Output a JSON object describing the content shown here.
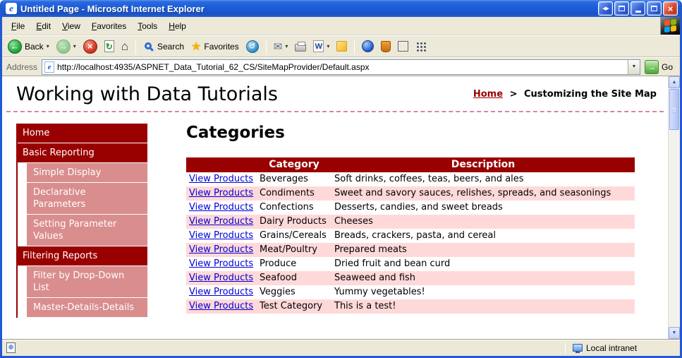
{
  "window": {
    "title": "Untitled Page - Microsoft Internet Explorer",
    "status_right_label": "Local intranet"
  },
  "menubar": {
    "items": [
      "File",
      "Edit",
      "View",
      "Favorites",
      "Tools",
      "Help"
    ]
  },
  "toolbar": {
    "back_label": "Back",
    "search_label": "Search",
    "favorites_label": "Favorites"
  },
  "addressbar": {
    "label": "Address",
    "url": "http://localhost:4935/ASPNET_Data_Tutorial_62_CS/SiteMapProvider/Default.aspx",
    "go_label": "Go"
  },
  "icons": {
    "back_arrow": "←",
    "forward_arrow": "→",
    "stop_glyph": "×",
    "refresh": "↻",
    "home": "⌂",
    "star": "★",
    "history": "↺",
    "mail": "✉",
    "caret": "▾",
    "word_w": "W",
    "go_arrow": "→",
    "up_arrow": "▲",
    "down_arrow": "▼",
    "drop_arrow": "▼",
    "close": "×",
    "arrows_pair": "◀▶",
    "ie_e": "e"
  },
  "page": {
    "title": "Working with Data Tutorials",
    "breadcrumb": {
      "home_label": "Home",
      "separator": ">",
      "current": "Customizing the Site Map"
    },
    "sidebar": [
      {
        "label": "Home",
        "level": 1
      },
      {
        "label": "Basic Reporting",
        "level": 1
      },
      {
        "label": "Simple Display",
        "level": 2
      },
      {
        "label": "Declarative Parameters",
        "level": 2
      },
      {
        "label": "Setting Parameter Values",
        "level": 2
      },
      {
        "label": "Filtering Reports",
        "level": 1
      },
      {
        "label": "Filter by Drop-Down List",
        "level": 2
      },
      {
        "label": "Master-Details-Details",
        "level": 2
      }
    ],
    "main": {
      "heading": "Categories",
      "table": {
        "headers": {
          "category": "Category",
          "description": "Description"
        },
        "link_label": "View Products",
        "rows": [
          {
            "category": "Beverages",
            "description": "Soft drinks, coffees, teas, beers, and ales"
          },
          {
            "category": "Condiments",
            "description": "Sweet and savory sauces, relishes, spreads, and seasonings"
          },
          {
            "category": "Confections",
            "description": "Desserts, candies, and sweet breads"
          },
          {
            "category": "Dairy Products",
            "description": "Cheeses"
          },
          {
            "category": "Grains/Cereals",
            "description": "Breads, crackers, pasta, and cereal"
          },
          {
            "category": "Meat/Poultry",
            "description": "Prepared meats"
          },
          {
            "category": "Produce",
            "description": "Dried fruit and bean curd"
          },
          {
            "category": "Seafood",
            "description": "Seaweed and fish"
          },
          {
            "category": "Veggies",
            "description": "Yummy vegetables!"
          },
          {
            "category": "Test Category",
            "description": "This is a test!"
          }
        ]
      }
    }
  },
  "colors": {
    "maroon": "#990000",
    "submenu_salmon": "#d98d8d",
    "row_alt_pink": "#ffd9d9",
    "link_blue": "#0000d8",
    "titlebar_blue": "#1b5cd8"
  }
}
